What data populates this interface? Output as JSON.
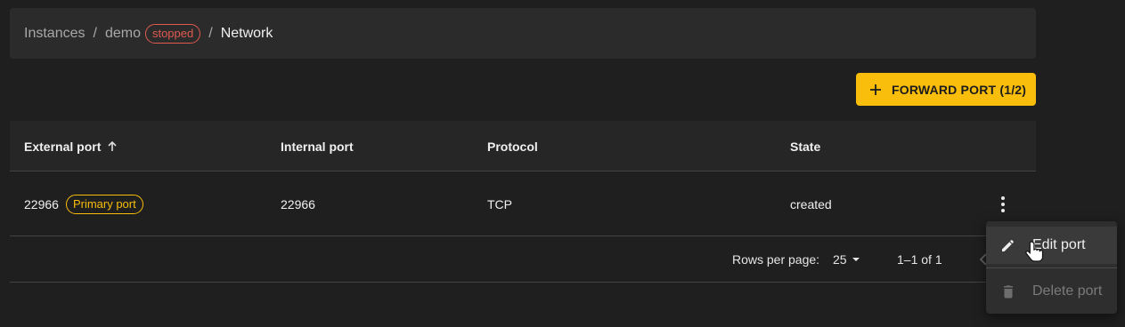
{
  "breadcrumb": {
    "root": "Instances",
    "instance": "demo",
    "instance_status": "stopped",
    "current": "Network",
    "separator": "/"
  },
  "actions": {
    "forward_port_label": "FORWARD PORT (1/2)"
  },
  "table": {
    "columns": [
      "External port",
      "Internal port",
      "Protocol",
      "State"
    ],
    "sorted_column": "External port",
    "sort_direction": "ascending",
    "rows": [
      {
        "external_port": "22966",
        "badge": "Primary port",
        "internal_port": "22966",
        "protocol": "TCP",
        "state": "created"
      }
    ]
  },
  "pagination": {
    "rows_per_page_label": "Rows per page:",
    "rows_per_page": "25",
    "range": "1–1 of 1"
  },
  "context_menu": {
    "items": [
      {
        "label": "Edit port",
        "icon": "pencil-icon",
        "enabled": true
      },
      {
        "label": "Delete port",
        "icon": "trash-icon",
        "enabled": false
      }
    ]
  },
  "colors": {
    "accent": "#f9bd0b",
    "danger": "#e05a4f",
    "background": "#1f1f1f",
    "surface": "#2b2b2b"
  }
}
